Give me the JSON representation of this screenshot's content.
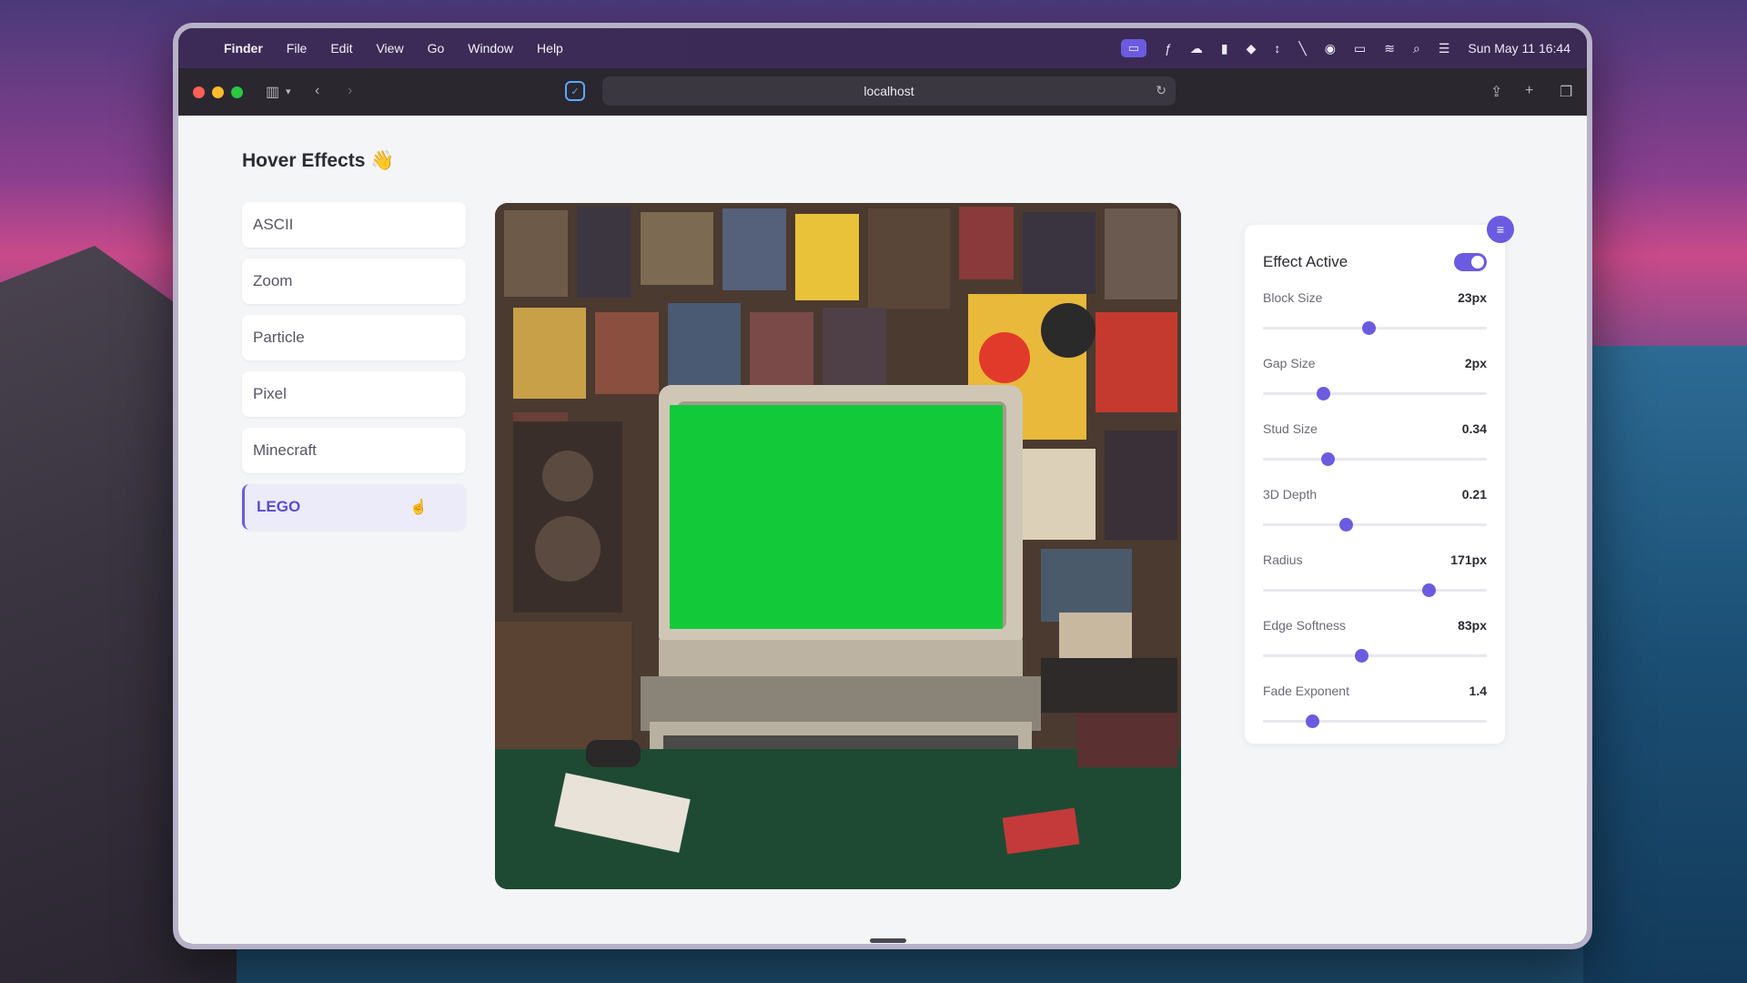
{
  "menubar": {
    "app": "Finder",
    "items": [
      "File",
      "Edit",
      "View",
      "Go",
      "Window",
      "Help"
    ],
    "datetime": "Sun May 11  16:44"
  },
  "browser": {
    "url": "localhost"
  },
  "page": {
    "title": "Hover Effects 👋"
  },
  "effects": [
    {
      "label": "ASCII",
      "active": false
    },
    {
      "label": "Zoom",
      "active": false
    },
    {
      "label": "Particle",
      "active": false
    },
    {
      "label": "Pixel",
      "active": false
    },
    {
      "label": "Minecraft",
      "active": false
    },
    {
      "label": "LEGO",
      "active": true
    }
  ],
  "panel": {
    "toggle_label": "Effect Active",
    "toggle_on": true,
    "sliders": [
      {
        "label": "Block Size",
        "value": "23px",
        "fraction": 0.47
      },
      {
        "label": "Gap Size",
        "value": "2px",
        "fraction": 0.27
      },
      {
        "label": "Stud Size",
        "value": "0.34",
        "fraction": 0.29
      },
      {
        "label": "3D Depth",
        "value": "0.21",
        "fraction": 0.37
      },
      {
        "label": "Radius",
        "value": "171px",
        "fraction": 0.74
      },
      {
        "label": "Edge Softness",
        "value": "83px",
        "fraction": 0.44
      },
      {
        "label": "Fade Exponent",
        "value": "1.4",
        "fraction": 0.22
      }
    ]
  },
  "colors": {
    "accent": "#6b5be0",
    "screen_green": "#12c93a"
  }
}
